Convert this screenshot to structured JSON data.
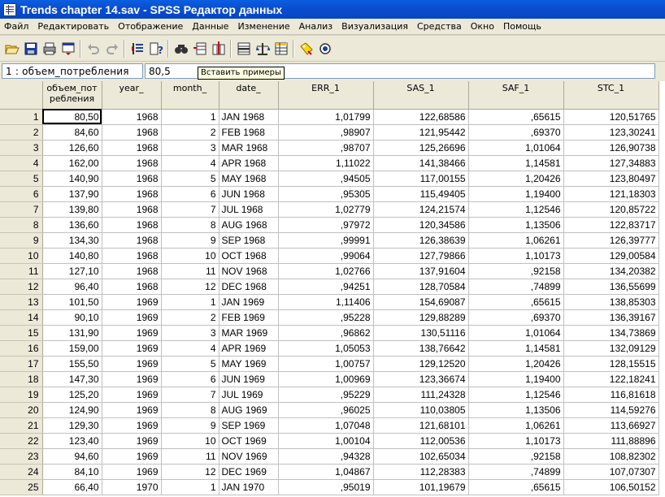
{
  "window": {
    "title": "Trends chapter 14.sav - SPSS Редактор данных",
    "icon": "spss-data-editor-icon"
  },
  "menu": [
    "Файл",
    "Редактировать",
    "Отображение",
    "Данные",
    "Изменение",
    "Анализ",
    "Визуализация",
    "Средства",
    "Окно",
    "Помощь"
  ],
  "toolbar": {
    "icons": [
      "open-icon",
      "save-icon",
      "print-icon",
      "dialog-recall-icon",
      "undo-icon",
      "redo-icon",
      "goto-case-icon",
      "variables-icon",
      "find-icon",
      "insert-case-icon",
      "insert-variable-icon",
      "split-file-icon",
      "weight-cases-icon",
      "select-cases-icon",
      "value-labels-icon",
      "use-sets-icon"
    ],
    "tooltip": "Вставить примеры"
  },
  "cell_editor": {
    "reference": "1 : объем_потребления",
    "value": "80,5"
  },
  "columns": [
    {
      "key": "rn",
      "label": "",
      "width": 52
    },
    {
      "key": "v1",
      "label": "объем_пот ребления",
      "width": 73
    },
    {
      "key": "v2",
      "label": "year_",
      "width": 73
    },
    {
      "key": "v3",
      "label": "month_",
      "width": 71
    },
    {
      "key": "v4",
      "label": "date_",
      "width": 73
    },
    {
      "key": "v5",
      "label": "ERR_1",
      "width": 117
    },
    {
      "key": "v6",
      "label": "SAS_1",
      "width": 117
    },
    {
      "key": "v7",
      "label": "SAF_1",
      "width": 117
    },
    {
      "key": "v8",
      "label": "STC_1",
      "width": 117
    }
  ],
  "rows": [
    [
      "1",
      "80,50",
      "1968",
      "1",
      "JAN 1968",
      "1,01799",
      "122,68586",
      ",65615",
      "120,51765"
    ],
    [
      "2",
      "84,60",
      "1968",
      "2",
      "FEB 1968",
      ",98907",
      "121,95442",
      ",69370",
      "123,30241"
    ],
    [
      "3",
      "126,60",
      "1968",
      "3",
      "MAR 1968",
      ",98707",
      "125,26696",
      "1,01064",
      "126,90738"
    ],
    [
      "4",
      "162,00",
      "1968",
      "4",
      "APR 1968",
      "1,11022",
      "141,38466",
      "1,14581",
      "127,34883"
    ],
    [
      "5",
      "140,90",
      "1968",
      "5",
      "MAY 1968",
      ",94505",
      "117,00155",
      "1,20426",
      "123,80497"
    ],
    [
      "6",
      "137,90",
      "1968",
      "6",
      "JUN 1968",
      ",95305",
      "115,49405",
      "1,19400",
      "121,18303"
    ],
    [
      "7",
      "139,80",
      "1968",
      "7",
      "JUL 1968",
      "1,02779",
      "124,21574",
      "1,12546",
      "120,85722"
    ],
    [
      "8",
      "136,60",
      "1968",
      "8",
      "AUG 1968",
      ",97972",
      "120,34586",
      "1,13506",
      "122,83717"
    ],
    [
      "9",
      "134,30",
      "1968",
      "9",
      "SEP 1968",
      ",99991",
      "126,38639",
      "1,06261",
      "126,39777"
    ],
    [
      "10",
      "140,80",
      "1968",
      "10",
      "OCT 1968",
      ",99064",
      "127,79866",
      "1,10173",
      "129,00584"
    ],
    [
      "11",
      "127,10",
      "1968",
      "11",
      "NOV 1968",
      "1,02766",
      "137,91604",
      ",92158",
      "134,20382"
    ],
    [
      "12",
      "96,40",
      "1968",
      "12",
      "DEC 1968",
      ",94251",
      "128,70584",
      ",74899",
      "136,55699"
    ],
    [
      "13",
      "101,50",
      "1969",
      "1",
      "JAN 1969",
      "1,11406",
      "154,69087",
      ",65615",
      "138,85303"
    ],
    [
      "14",
      "90,10",
      "1969",
      "2",
      "FEB 1969",
      ",95228",
      "129,88289",
      ",69370",
      "136,39167"
    ],
    [
      "15",
      "131,90",
      "1969",
      "3",
      "MAR 1969",
      ",96862",
      "130,51116",
      "1,01064",
      "134,73869"
    ],
    [
      "16",
      "159,00",
      "1969",
      "4",
      "APR 1969",
      "1,05053",
      "138,76642",
      "1,14581",
      "132,09129"
    ],
    [
      "17",
      "155,50",
      "1969",
      "5",
      "MAY 1969",
      "1,00757",
      "129,12520",
      "1,20426",
      "128,15515"
    ],
    [
      "18",
      "147,30",
      "1969",
      "6",
      "JUN 1969",
      "1,00969",
      "123,36674",
      "1,19400",
      "122,18241"
    ],
    [
      "19",
      "125,20",
      "1969",
      "7",
      "JUL 1969",
      ",95229",
      "111,24328",
      "1,12546",
      "116,81618"
    ],
    [
      "20",
      "124,90",
      "1969",
      "8",
      "AUG 1969",
      ",96025",
      "110,03805",
      "1,13506",
      "114,59276"
    ],
    [
      "21",
      "129,30",
      "1969",
      "9",
      "SEP 1969",
      "1,07048",
      "121,68101",
      "1,06261",
      "113,66927"
    ],
    [
      "22",
      "123,40",
      "1969",
      "10",
      "OCT 1969",
      "1,00104",
      "112,00536",
      "1,10173",
      "111,88896"
    ],
    [
      "23",
      "94,60",
      "1969",
      "11",
      "NOV 1969",
      ",94328",
      "102,65034",
      ",92158",
      "108,82302"
    ],
    [
      "24",
      "84,10",
      "1969",
      "12",
      "DEC 1969",
      "1,04867",
      "112,28383",
      ",74899",
      "107,07307"
    ],
    [
      "25",
      "66,40",
      "1970",
      "1",
      "JAN 1970",
      ",95019",
      "101,19679",
      ",65615",
      "106,50152"
    ]
  ],
  "active_cell": {
    "row": 0,
    "col": 1
  }
}
